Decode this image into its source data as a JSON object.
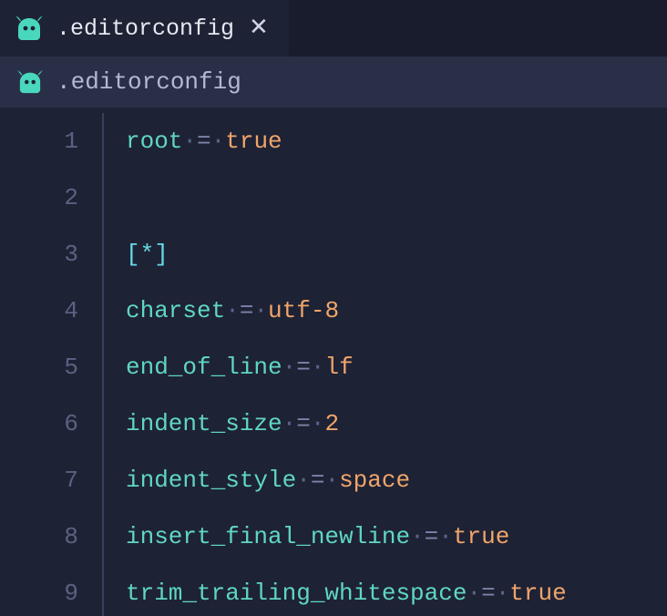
{
  "tab": {
    "label": ".editorconfig",
    "icon": "editorconfig-icon"
  },
  "breadcrumb": {
    "label": ".editorconfig",
    "icon": "editorconfig-icon"
  },
  "glyphs": {
    "dot": "·",
    "close": "✕"
  },
  "lines": [
    {
      "n": "1",
      "tokens": [
        {
          "t": "root",
          "c": "key"
        },
        {
          "t": "dot"
        },
        {
          "t": "=",
          "c": "op"
        },
        {
          "t": "dot"
        },
        {
          "t": "true",
          "c": "val"
        }
      ]
    },
    {
      "n": "2",
      "tokens": []
    },
    {
      "n": "3",
      "tokens": [
        {
          "t": "[",
          "c": "sec-b"
        },
        {
          "t": "*",
          "c": "sec-s"
        },
        {
          "t": "]",
          "c": "sec-b"
        }
      ]
    },
    {
      "n": "4",
      "tokens": [
        {
          "t": "charset",
          "c": "key"
        },
        {
          "t": "dot"
        },
        {
          "t": "=",
          "c": "op"
        },
        {
          "t": "dot"
        },
        {
          "t": "utf-8",
          "c": "val"
        }
      ]
    },
    {
      "n": "5",
      "tokens": [
        {
          "t": "end_of_line",
          "c": "key"
        },
        {
          "t": "dot"
        },
        {
          "t": "=",
          "c": "op"
        },
        {
          "t": "dot"
        },
        {
          "t": "lf",
          "c": "val"
        }
      ]
    },
    {
      "n": "6",
      "tokens": [
        {
          "t": "indent_size",
          "c": "key"
        },
        {
          "t": "dot"
        },
        {
          "t": "=",
          "c": "op"
        },
        {
          "t": "dot"
        },
        {
          "t": "2",
          "c": "val"
        }
      ]
    },
    {
      "n": "7",
      "tokens": [
        {
          "t": "indent_style",
          "c": "key"
        },
        {
          "t": "dot"
        },
        {
          "t": "=",
          "c": "op"
        },
        {
          "t": "dot"
        },
        {
          "t": "space",
          "c": "val"
        }
      ]
    },
    {
      "n": "8",
      "tokens": [
        {
          "t": "insert_final_newline",
          "c": "key"
        },
        {
          "t": "dot"
        },
        {
          "t": "=",
          "c": "op"
        },
        {
          "t": "dot"
        },
        {
          "t": "true",
          "c": "val"
        }
      ]
    },
    {
      "n": "9",
      "tokens": [
        {
          "t": "trim_trailing_whitespace",
          "c": "key"
        },
        {
          "t": "dot"
        },
        {
          "t": "=",
          "c": "op"
        },
        {
          "t": "dot"
        },
        {
          "t": "true",
          "c": "val"
        }
      ]
    }
  ]
}
